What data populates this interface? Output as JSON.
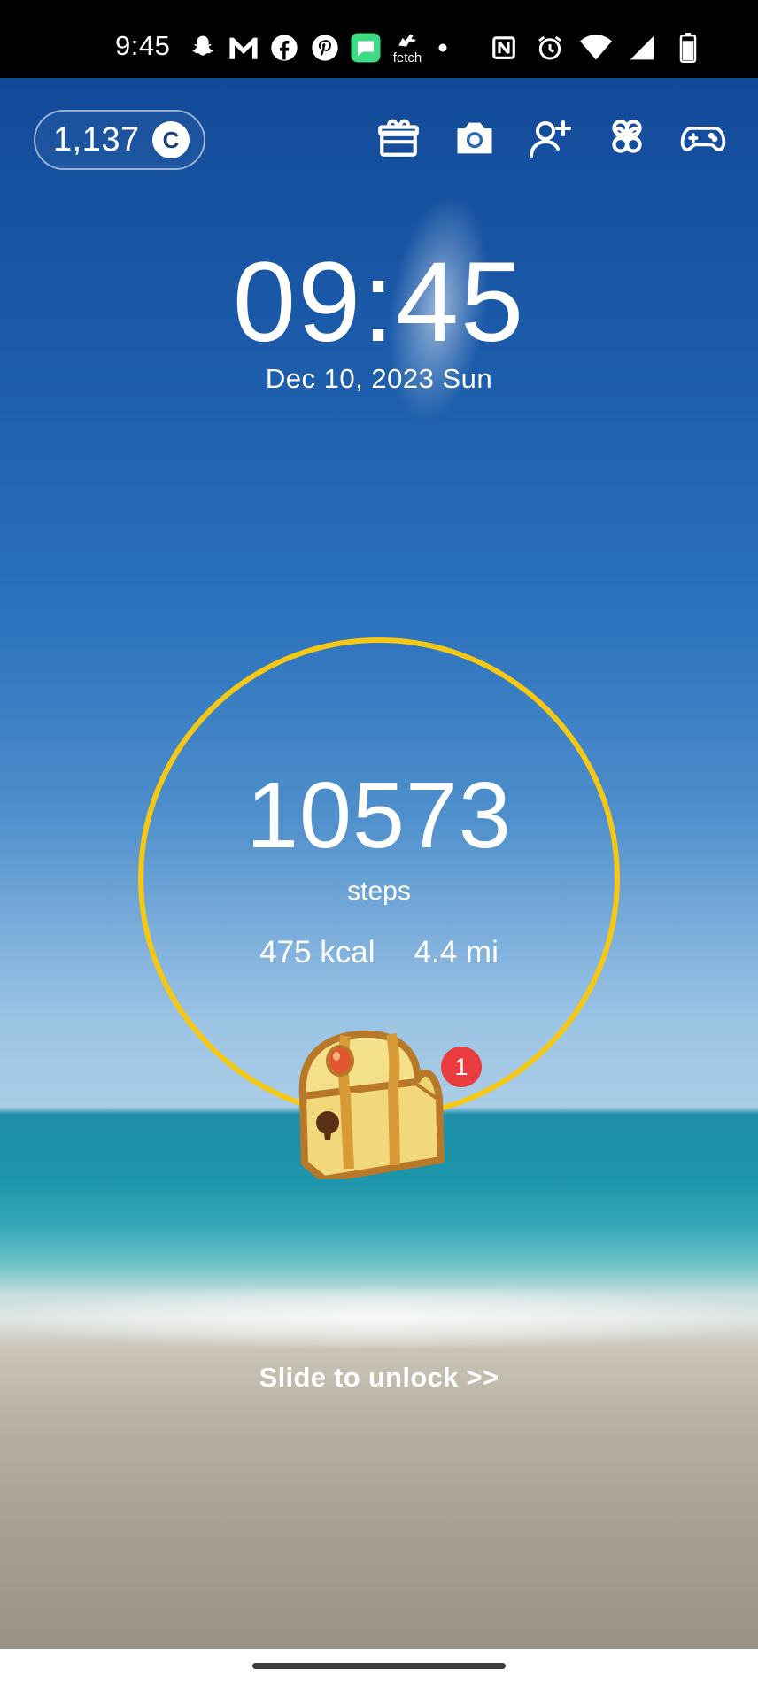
{
  "status_bar": {
    "time": "9:45",
    "fetch_label": "fetch",
    "left_icons": [
      "snapchat-icon",
      "gmail-icon",
      "facebook-icon",
      "pinterest-icon",
      "messages-icon",
      "fetch-icon",
      "dot-icon"
    ],
    "right_icons": [
      "nfc-icon",
      "alarm-icon",
      "wifi-icon",
      "signal-icon",
      "battery-icon"
    ]
  },
  "toolbar": {
    "coins": "1,137",
    "coin_symbol": "C",
    "icons": [
      "gift-icon",
      "camera-icon",
      "add-friend-icon",
      "clover-icon",
      "gamepad-icon"
    ]
  },
  "clock": {
    "time": "09:45",
    "date": "Dec 10, 2023 Sun"
  },
  "steps": {
    "count": "10573",
    "label": "steps",
    "kcal": "475 kcal",
    "distance": "4.4 mi",
    "ring_color": "#f5c815"
  },
  "chest": {
    "badge": "1",
    "badge_color": "#ea3b3f"
  },
  "unlock_text": "Slide to unlock >>"
}
